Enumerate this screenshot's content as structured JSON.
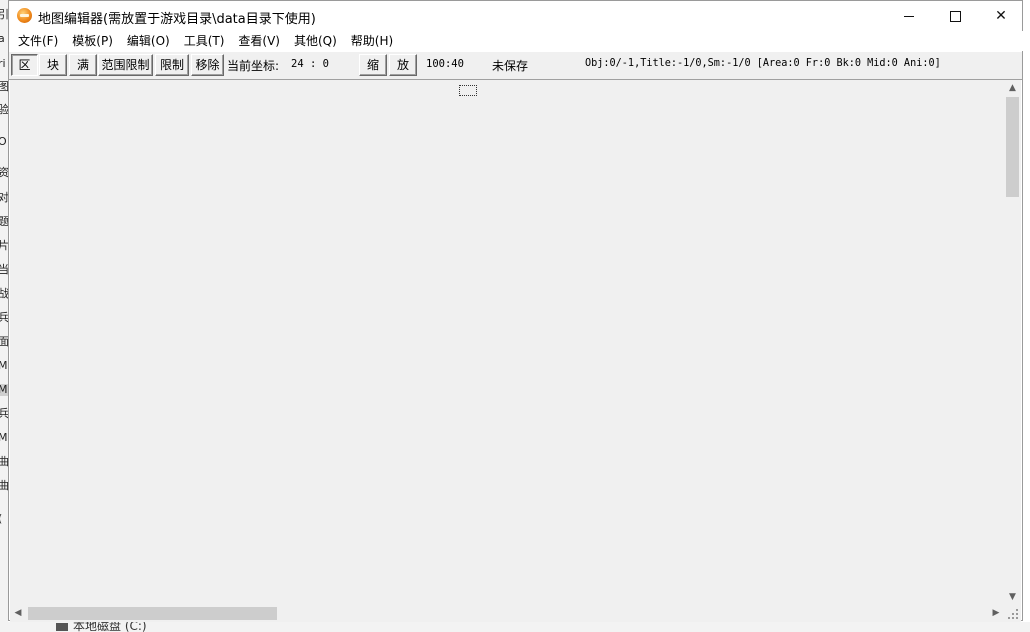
{
  "background": {
    "left_chars": [
      "引",
      "a",
      "图",
      "ri",
      "验",
      "O",
      "资",
      "对",
      "题",
      "片",
      "当",
      "战",
      "兵",
      "面",
      "M",
      "M",
      "兵",
      "M",
      "曲",
      "曲",
      "("
    ],
    "drive_label": "本地磁盘 (C:)"
  },
  "window": {
    "title": "地图编辑器(需放置于游戏目录\\data目录下使用)",
    "close_glyph": "✕"
  },
  "menu": {
    "items": [
      "文件(F)",
      "模板(P)",
      "编辑(O)",
      "工具(T)",
      "查看(V)",
      "其他(Q)",
      "帮助(H)"
    ]
  },
  "toolbar": {
    "btn_area": "区",
    "btn_block": "块",
    "btn_full": "满",
    "btn_range_limit": "范围限制",
    "btn_limit": "限制",
    "btn_remove": "移除",
    "coord_label": "当前坐标:",
    "coord_value": "24 : 0",
    "btn_shrink": "缩",
    "btn_zoom": "放",
    "size": "100:40",
    "save_status": "未保存",
    "info": "Obj:0/-1,Title:-1/0,Sm:-1/0 [Area:0 Fr:0 Bk:0 Mid:0 Ani:0]"
  },
  "scrollbars": {
    "up": "▲",
    "down": "▼",
    "left": "◀",
    "right": "▶"
  }
}
